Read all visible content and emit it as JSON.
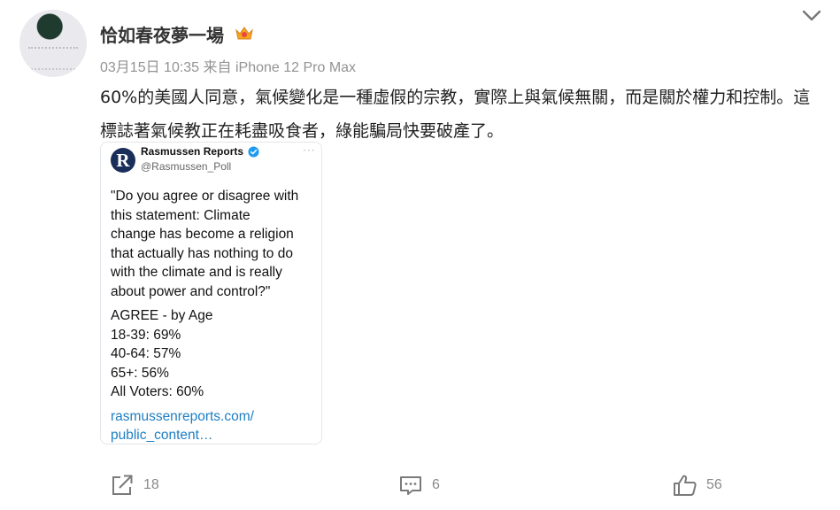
{
  "post": {
    "username": "恰如春夜夢一場",
    "meta": "03月15日 10:35  来自 iPhone 12 Pro Max",
    "text": "60%的美國人同意，氣候變化是一種虛假的宗教，實際上與氣候無關，而是關於權力和控制。這標誌著氣候教正在耗盡吸食者，綠能騙局快要破產了。",
    "icons": {
      "menu": "chevron-down-icon",
      "badge": "crown-badge-icon",
      "share": "share-icon",
      "comment": "comment-icon",
      "like": "thumbs-up-icon"
    }
  },
  "tweet": {
    "logo_letter": "R",
    "name": "Rasmussen Reports",
    "handle": "@Rasmussen_Poll",
    "more": "···",
    "quote_lines": [
      "\"Do you agree or disagree with",
      "this statement: Climate",
      "change has become a religion",
      "that actually has nothing to do",
      "with the climate and is really",
      "about power and control?\""
    ],
    "stats_lines": [
      "AGREE - by Age",
      "18-39: 69%",
      "40-64: 57%",
      "65+: 56%",
      "All Voters: 60%"
    ],
    "link_lines": [
      "rasmussenreports.com/",
      "public_content…"
    ]
  },
  "actions": {
    "share_count": "18",
    "comment_count": "6",
    "like_count": "56"
  },
  "colors": {
    "text": "#222222",
    "meta": "#939393",
    "link": "#1d7ec2",
    "verified": "#1d9bf0",
    "crown": "#f5a623"
  }
}
